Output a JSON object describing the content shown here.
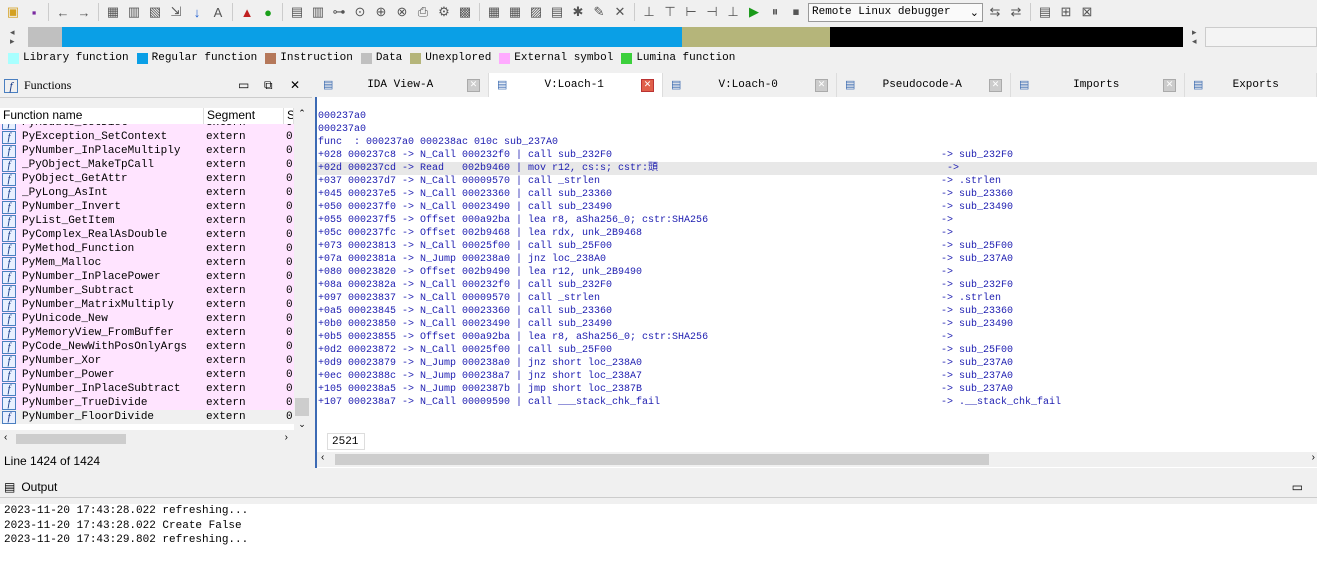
{
  "toolbar": {
    "icons": [
      "open-icon",
      "save-icon",
      "back-icon",
      "forward-icon",
      "binary-icon",
      "text-icon",
      "hex-icon",
      "jump-icon",
      "down-arrow-icon",
      "font-icon",
      "stop-icon",
      "green-circle-icon",
      "list-icon",
      "tree-icon",
      "graph-icon",
      "search-icon",
      "find-icon",
      "xref-icon",
      "print-icon",
      "settings-icon",
      "color-icon",
      "code-icon",
      "data-icon",
      "struct-icon",
      "enum-icon",
      "patch-icon",
      "edit-icon",
      "close-x-icon",
      "callgraph-icon",
      "flow-icon",
      "refs-icon",
      "proximity-icon",
      "chart-icon"
    ],
    "debugger_select": "Remote Linux debugger",
    "play": "start-process-icon",
    "pause": "pause-icon",
    "stop": "stop-process-icon"
  },
  "navband": {
    "segments": [
      [
        "#c0c0c0",
        34
      ],
      [
        "#0a9fe6",
        620
      ],
      [
        "#b5b57a",
        148
      ],
      [
        "#000000",
        353
      ]
    ]
  },
  "legend": [
    {
      "label": "Library function",
      "color": "#a8ffff"
    },
    {
      "label": "Regular function",
      "color": "#0a9fe6"
    },
    {
      "label": "Instruction",
      "color": "#b5785a"
    },
    {
      "label": "Data",
      "color": "#c0c0c0"
    },
    {
      "label": "Unexplored",
      "color": "#b5b57a"
    },
    {
      "label": "External symbol",
      "color": "#ffaaff"
    },
    {
      "label": "Lumina function",
      "color": "#3cd03c"
    }
  ],
  "functions": {
    "title": "Functions",
    "columns": [
      "Function name",
      "Segment",
      "S"
    ],
    "rows": [
      "PyModule_GetDict",
      "PyException_SetContext",
      "PyNumber_InPlaceMultiply",
      "_PyObject_MakeTpCall",
      "PyObject_GetAttr",
      "_PyLong_AsInt",
      "PyNumber_Invert",
      "PyList_GetItem",
      "PyComplex_RealAsDouble",
      "PyMethod_Function",
      "PyMem_Malloc",
      "PyNumber_InPlacePower",
      "PyNumber_Subtract",
      "PyNumber_MatrixMultiply",
      "PyUnicode_New",
      "PyMemoryView_FromBuffer",
      "PyCode_NewWithPosOnlyArgs",
      "PyNumber_Xor",
      "PyNumber_Power",
      "PyNumber_InPlaceSubtract",
      "PyNumber_TrueDivide",
      "PyNumber_FloorDivide"
    ],
    "segment": "extern",
    "s": "0",
    "status": "Line 1424 of 1424"
  },
  "tabs": [
    {
      "label": "IDA View-A"
    },
    {
      "label": "V:Loach-1",
      "active": true
    },
    {
      "label": "V:Loach-0"
    },
    {
      "label": "Pseudocode-A"
    },
    {
      "label": "Imports"
    },
    {
      "label": "Exports"
    }
  ],
  "code": {
    "lines": [
      {
        "l": "000237a0",
        "r": ""
      },
      {
        "l": "000237a0",
        "r": ""
      },
      {
        "l": "func  : 000237a0 000238ac 010c sub_237A0",
        "r": ""
      },
      {
        "l": "+028 000237c8 -> N_Call 000232f0 | call sub_232F0",
        "r": "-> sub_232F0"
      },
      {
        "l": "+02d 000237cd -> Read   002b9460 | mov r12, cs:s; cstr:頭",
        "r": " ->",
        "hl": true
      },
      {
        "l": "+037 000237d7 -> N_Call 00009570 | call _strlen",
        "r": "-> .strlen"
      },
      {
        "l": "+045 000237e5 -> N_Call 00023360 | call sub_23360",
        "r": "-> sub_23360"
      },
      {
        "l": "+050 000237f0 -> N_Call 00023490 | call sub_23490",
        "r": "-> sub_23490"
      },
      {
        "l": "+055 000237f5 -> Offset 000a92ba | lea r8, aSha256_0; cstr:SHA256",
        "r": "->"
      },
      {
        "l": "+05c 000237fc -> Offset 002b9468 | lea rdx, unk_2B9468",
        "r": "->"
      },
      {
        "l": "+073 00023813 -> N_Call 00025f00 | call sub_25F00",
        "r": "-> sub_25F00"
      },
      {
        "l": "+07a 0002381a -> N_Jump 000238a0 | jnz loc_238A0",
        "r": "-> sub_237A0"
      },
      {
        "l": "+080 00023820 -> Offset 002b9490 | lea r12, unk_2B9490",
        "r": "->"
      },
      {
        "l": "+08a 0002382a -> N_Call 000232f0 | call sub_232F0",
        "r": "-> sub_232F0"
      },
      {
        "l": "+097 00023837 -> N_Call 00009570 | call _strlen",
        "r": "-> .strlen"
      },
      {
        "l": "+0a5 00023845 -> N_Call 00023360 | call sub_23360",
        "r": "-> sub_23360"
      },
      {
        "l": "+0b0 00023850 -> N_Call 00023490 | call sub_23490",
        "r": "-> sub_23490"
      },
      {
        "l": "+0b5 00023855 -> Offset 000a92ba | lea r8, aSha256_0; cstr:SHA256",
        "r": "->"
      },
      {
        "l": "+0d2 00023872 -> N_Call 00025f00 | call sub_25F00",
        "r": "-> sub_25F00"
      },
      {
        "l": "+0d9 00023879 -> N_Jump 000238a0 | jnz short loc_238A0",
        "r": "-> sub_237A0"
      },
      {
        "l": "+0ec 0002388c -> N_Jump 000238a7 | jnz short loc_238A7",
        "r": "-> sub_237A0"
      },
      {
        "l": "+105 000238a5 -> N_Jump 0002387b | jmp short loc_2387B",
        "r": "-> sub_237A0"
      },
      {
        "l": "+107 000238a7 -> N_Call 00009590 | call ___stack_chk_fail",
        "r": "-> .__stack_chk_fail"
      }
    ],
    "line_number": "2521"
  },
  "output": {
    "title": "Output",
    "lines": [
      "2023-11-20 17:43:28.022 refreshing...",
      "2023-11-20 17:43:28.022 Create False",
      "2023-11-20 17:43:29.802 refreshing..."
    ]
  }
}
